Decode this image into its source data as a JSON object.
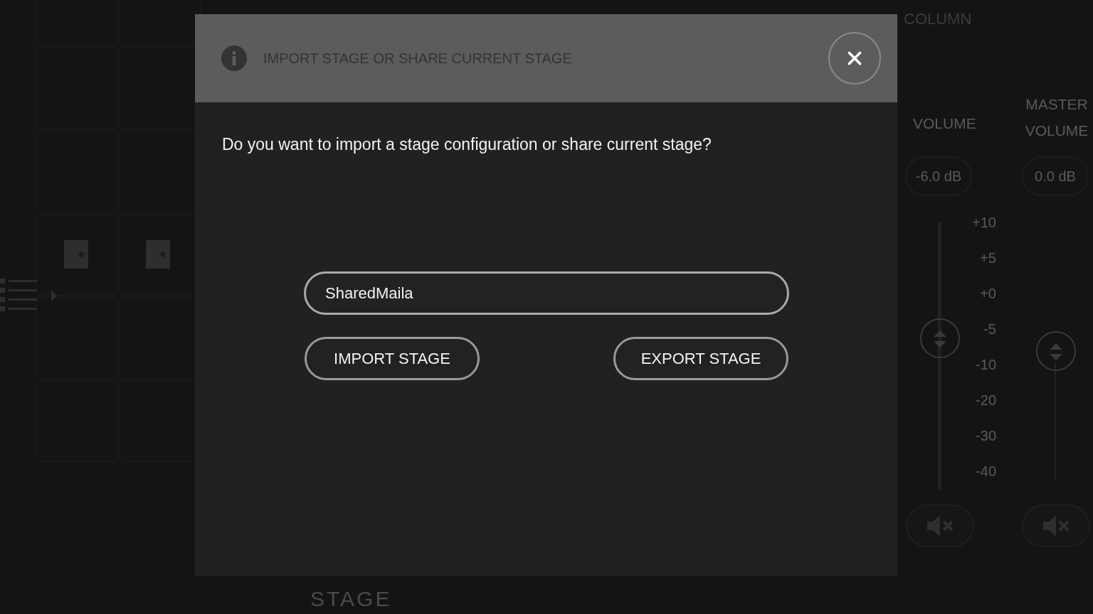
{
  "background": {
    "panel_title": "COLUMN",
    "volume": {
      "label": "VOLUME",
      "reading": "-6.0 dB",
      "scale": [
        "+10",
        "+5",
        "+0",
        "-5",
        "-10",
        "-20",
        "-30",
        "-40"
      ]
    },
    "master_volume": {
      "label": "MASTER VOLUME",
      "reading": "0.0 dB"
    },
    "stage_label": "STAGE"
  },
  "dialog": {
    "title": "IMPORT STAGE OR SHARE CURRENT STAGE",
    "message": "Do you want to import a stage configuration or share current stage?",
    "input": {
      "value": "SharedMaila"
    },
    "buttons": [
      "IMPORT STAGE",
      "EXPORT STAGE"
    ]
  }
}
